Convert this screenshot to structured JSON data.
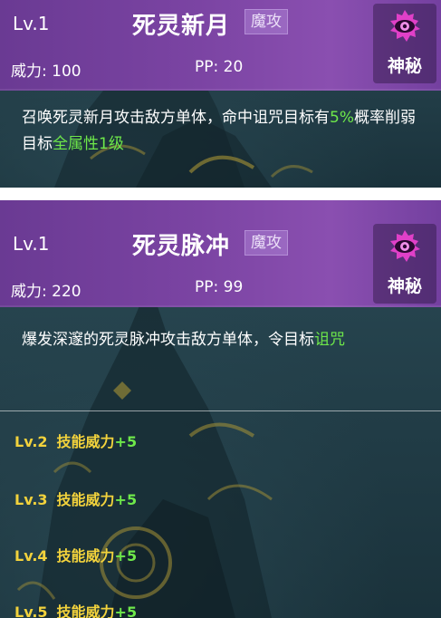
{
  "cards": [
    {
      "level": "Lv.1",
      "name": "死灵新月",
      "type_tag": "魔攻",
      "power": "威力: 100",
      "pp": "PP: 20",
      "attribute": "神秘",
      "description": {
        "part1": "召唤死灵新月攻击敌方单体，命中诅咒目标有",
        "highlight1": "5%",
        "part2": "概率削弱目标",
        "highlight2": "全属性1级"
      }
    },
    {
      "level": "Lv.1",
      "name": "死灵脉冲",
      "type_tag": "魔攻",
      "power": "威力: 220",
      "pp": "PP: 99",
      "attribute": "神秘",
      "description": {
        "part1": "爆发深邃的死灵脉冲攻击敌方单体，令目标",
        "highlight1": "诅咒"
      },
      "upgrades": [
        {
          "level": "Lv.2",
          "label": "技能威力",
          "bonus": "+5"
        },
        {
          "level": "Lv.3",
          "label": "技能威力",
          "bonus": "+5"
        },
        {
          "level": "Lv.4",
          "label": "技能威力",
          "bonus": "+5"
        },
        {
          "level": "Lv.5",
          "label": "技能威力",
          "bonus": "+5"
        }
      ]
    }
  ],
  "colors": {
    "header_purple": "#7b44a3",
    "panel_teal": "#213c46",
    "highlight_green": "#6ee84a",
    "upgrade_yellow": "#f2d23c",
    "attribute_icon": "#e040c8"
  },
  "icons": {
    "attribute_icon": "mystic-eye-icon"
  }
}
